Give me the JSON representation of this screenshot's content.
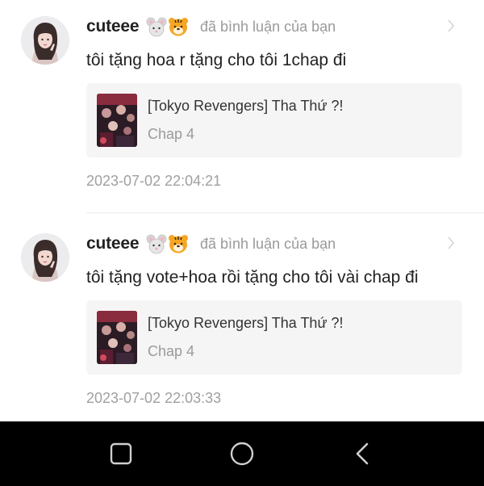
{
  "notifications": [
    {
      "username": "cuteee",
      "badges": [
        "mouse-face-emoji",
        "tiger-face-emoji"
      ],
      "action": "đã bình luận của bạn",
      "comment": "tôi tặng hoa r tặng cho tôi 1chap đi",
      "story": {
        "title": "[Tokyo Revengers] Tha Thứ ?!",
        "chapter": "Chap 4"
      },
      "timestamp": "2023-07-02 22:04:21"
    },
    {
      "username": "cuteee",
      "badges": [
        "mouse-face-emoji",
        "tiger-face-emoji"
      ],
      "action": "đã bình luận của bạn",
      "comment": "tôi tặng vote+hoa rồi tặng cho tôi vài chap đi",
      "story": {
        "title": "[Tokyo Revengers] Tha Thứ ?!",
        "chapter": "Chap 4"
      },
      "timestamp": "2023-07-02 22:03:33"
    }
  ],
  "system_nav": {
    "buttons": [
      "recent-apps-icon",
      "home-icon",
      "back-icon"
    ],
    "background": "#000000"
  },
  "colors": {
    "username": "#222222",
    "muted": "#9a9a9a",
    "card_bg": "#f5f5f5"
  }
}
